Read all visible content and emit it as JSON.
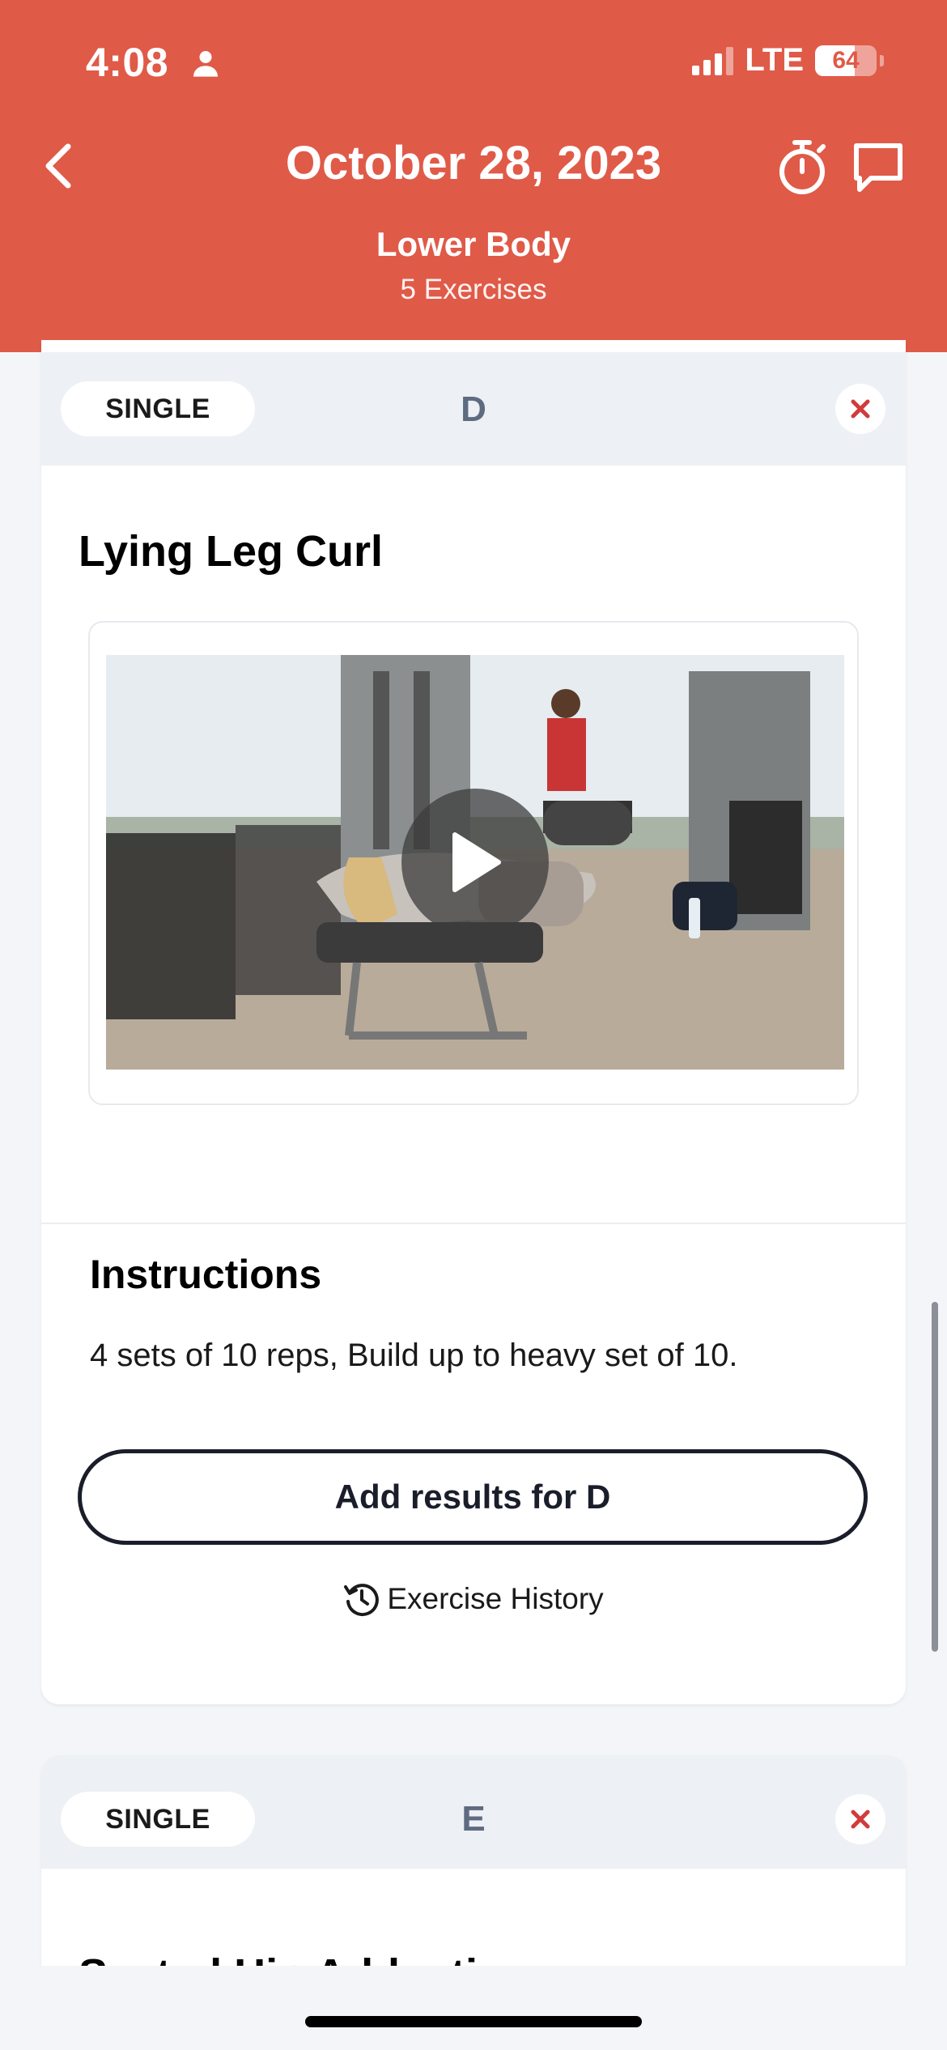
{
  "status_bar": {
    "time": "4:08",
    "network": "LTE",
    "battery_level": "64",
    "battery_fraction": 0.64
  },
  "header": {
    "title": "October 28, 2023",
    "subtitle": "Lower Body",
    "exercise_count": "5 Exercises",
    "icons": [
      "chevron-left-icon",
      "stopwatch-icon",
      "chat-bubble-icon"
    ]
  },
  "exercise_d": {
    "type": "SINGLE",
    "letter": "D",
    "name": "Lying Leg Curl",
    "instructions_title": "Instructions",
    "instructions": "4 sets of 10 reps, Build up to heavy set of 10.",
    "add_results_label": "Add results for D",
    "history_label": "Exercise History"
  },
  "exercise_e": {
    "type": "SINGLE",
    "letter": "E",
    "name": "Seated Hip Adduction"
  },
  "colors": {
    "header_bg": "#e05a48",
    "close_icon": "#d13b3b",
    "letter": "#5e6b80"
  }
}
